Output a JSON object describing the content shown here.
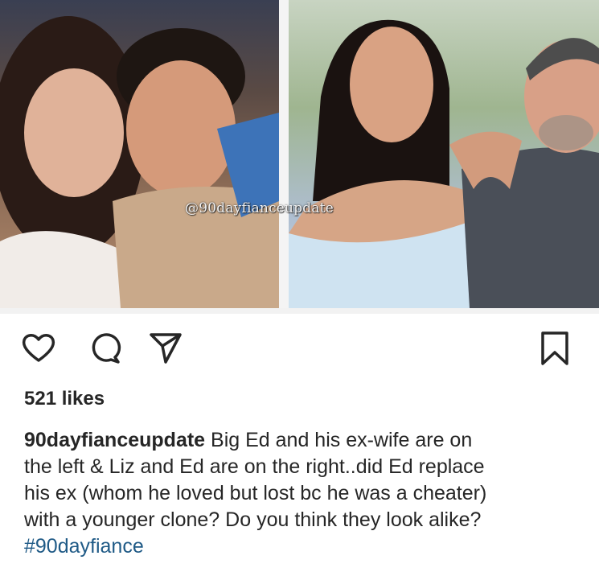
{
  "post": {
    "watermark": "@90dayfianceupdate",
    "likes": "521 likes",
    "username": "90dayfianceupdate",
    "caption_lines": [
      " Big Ed and his ex-wife are on",
      "the left & Liz and Ed are on the right..did Ed replace",
      "his ex (whom he loved but lost bc he was a cheater)",
      "with a younger clone? Do you think they look alike?"
    ],
    "hashtag": "#90dayfiance"
  },
  "actions": {
    "icons": [
      "heart-icon",
      "comment-icon",
      "share-icon",
      "bookmark-icon"
    ]
  },
  "colors": {
    "text": "#262626",
    "hashtag": "#1f5a86",
    "background": "#ffffff"
  }
}
